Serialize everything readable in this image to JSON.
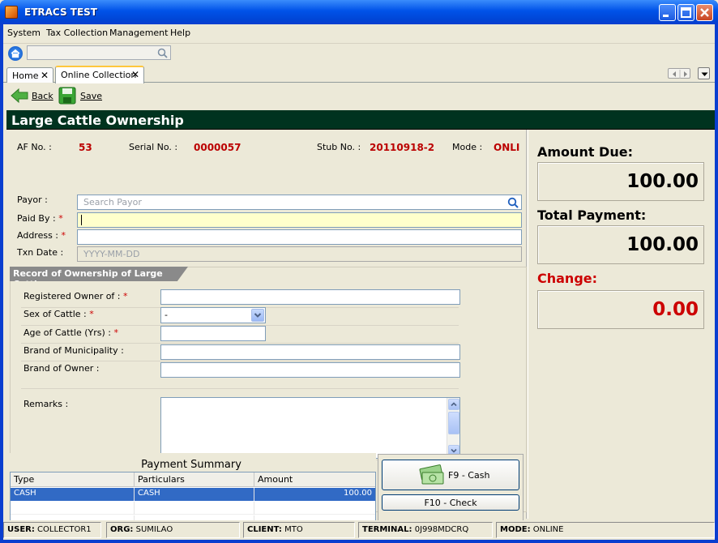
{
  "window": {
    "title": "ETRACS TEST"
  },
  "menu": [
    "System",
    "Tax Collection",
    "Management",
    "Help"
  ],
  "tabs": [
    {
      "label": "Home"
    },
    {
      "label": "Online Collection"
    }
  ],
  "actions": {
    "back_label": "Back",
    "save_label": "Save"
  },
  "form": {
    "title": "Large Cattle Ownership",
    "af_label": "AF No. :",
    "af_value": "53",
    "serial_label": "Serial No. :",
    "serial_value": "0000057",
    "stub_label": "Stub No. :",
    "stub_value": "20110918-2",
    "mode_label": "Mode :",
    "mode_value": "ONLI",
    "payor_label": "Payor :",
    "payor_placeholder": "Search Payor",
    "paidby_label": "Paid By :",
    "paidby_value": "",
    "address_label": "Address :",
    "txndate_label": "Txn Date :",
    "txndate_placeholder": "YYYY-MM-DD",
    "required_mark": "*"
  },
  "section": {
    "title": "Record of Ownership of Large Cattle",
    "registered_owner_label": "Registered Owner of :",
    "sex_label": "Sex of Cattle :",
    "sex_value": "-",
    "age_label": "Age of Cattle (Yrs) :",
    "brand_municipality_label": "Brand of Municipality :",
    "brand_owner_label": "Brand of Owner :",
    "remarks_label": "Remarks :"
  },
  "payment_summary": {
    "title": "Payment Summary",
    "columns": [
      "Type",
      "Particulars",
      "Amount"
    ],
    "rows": [
      {
        "type": "CASH",
        "particulars": "CASH",
        "amount": "100.00"
      }
    ],
    "cash_button": "F9 - Cash",
    "check_button": "F10 - Check"
  },
  "totals": {
    "amount_due_label": "Amount Due:",
    "amount_due": "100.00",
    "total_payment_label": "Total Payment:",
    "total_payment": "100.00",
    "change_label": "Change:",
    "change": "0.00"
  },
  "status": {
    "user_label": "USER:",
    "user": "COLLECTOR1",
    "org_label": "ORG:",
    "org": "SUMILAO",
    "client_label": "CLIENT:",
    "client": "MTO",
    "terminal_label": "TERMINAL:",
    "terminal": "0J998MDCRQ",
    "mode_label": "MODE:",
    "mode": "ONLINE"
  },
  "colors": {
    "heading_bg": "#00331f",
    "value_red": "#bb0000",
    "selection": "#316ac5"
  }
}
